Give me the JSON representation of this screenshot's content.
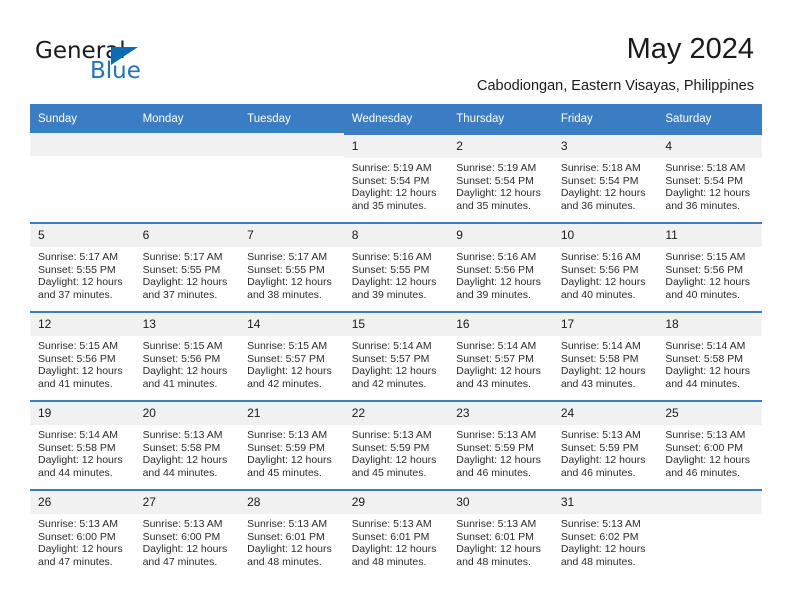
{
  "brand": {
    "name_part1": "General",
    "name_part2": "Blue",
    "accent_color": "#0b6cb6"
  },
  "header": {
    "title": "May 2024",
    "subtitle": "Cabodiongan, Eastern Visayas, Philippines",
    "header_bg_color": "#3b7dc4",
    "daynum_bg_color": "#f1f1f1"
  },
  "weekday_headers": [
    "Sunday",
    "Monday",
    "Tuesday",
    "Wednesday",
    "Thursday",
    "Friday",
    "Saturday"
  ],
  "weeks": [
    [
      {
        "day": "",
        "blank": true
      },
      {
        "day": "",
        "blank": true
      },
      {
        "day": "",
        "blank": true
      },
      {
        "day": "1",
        "sunrise": "Sunrise: 5:19 AM",
        "sunset": "Sunset: 5:54 PM",
        "daylight_line1": "Daylight: 12 hours",
        "daylight_line2": "and 35 minutes."
      },
      {
        "day": "2",
        "sunrise": "Sunrise: 5:19 AM",
        "sunset": "Sunset: 5:54 PM",
        "daylight_line1": "Daylight: 12 hours",
        "daylight_line2": "and 35 minutes."
      },
      {
        "day": "3",
        "sunrise": "Sunrise: 5:18 AM",
        "sunset": "Sunset: 5:54 PM",
        "daylight_line1": "Daylight: 12 hours",
        "daylight_line2": "and 36 minutes."
      },
      {
        "day": "4",
        "sunrise": "Sunrise: 5:18 AM",
        "sunset": "Sunset: 5:54 PM",
        "daylight_line1": "Daylight: 12 hours",
        "daylight_line2": "and 36 minutes."
      }
    ],
    [
      {
        "day": "5",
        "sunrise": "Sunrise: 5:17 AM",
        "sunset": "Sunset: 5:55 PM",
        "daylight_line1": "Daylight: 12 hours",
        "daylight_line2": "and 37 minutes."
      },
      {
        "day": "6",
        "sunrise": "Sunrise: 5:17 AM",
        "sunset": "Sunset: 5:55 PM",
        "daylight_line1": "Daylight: 12 hours",
        "daylight_line2": "and 37 minutes."
      },
      {
        "day": "7",
        "sunrise": "Sunrise: 5:17 AM",
        "sunset": "Sunset: 5:55 PM",
        "daylight_line1": "Daylight: 12 hours",
        "daylight_line2": "and 38 minutes."
      },
      {
        "day": "8",
        "sunrise": "Sunrise: 5:16 AM",
        "sunset": "Sunset: 5:55 PM",
        "daylight_line1": "Daylight: 12 hours",
        "daylight_line2": "and 39 minutes."
      },
      {
        "day": "9",
        "sunrise": "Sunrise: 5:16 AM",
        "sunset": "Sunset: 5:56 PM",
        "daylight_line1": "Daylight: 12 hours",
        "daylight_line2": "and 39 minutes."
      },
      {
        "day": "10",
        "sunrise": "Sunrise: 5:16 AM",
        "sunset": "Sunset: 5:56 PM",
        "daylight_line1": "Daylight: 12 hours",
        "daylight_line2": "and 40 minutes."
      },
      {
        "day": "11",
        "sunrise": "Sunrise: 5:15 AM",
        "sunset": "Sunset: 5:56 PM",
        "daylight_line1": "Daylight: 12 hours",
        "daylight_line2": "and 40 minutes."
      }
    ],
    [
      {
        "day": "12",
        "sunrise": "Sunrise: 5:15 AM",
        "sunset": "Sunset: 5:56 PM",
        "daylight_line1": "Daylight: 12 hours",
        "daylight_line2": "and 41 minutes."
      },
      {
        "day": "13",
        "sunrise": "Sunrise: 5:15 AM",
        "sunset": "Sunset: 5:56 PM",
        "daylight_line1": "Daylight: 12 hours",
        "daylight_line2": "and 41 minutes."
      },
      {
        "day": "14",
        "sunrise": "Sunrise: 5:15 AM",
        "sunset": "Sunset: 5:57 PM",
        "daylight_line1": "Daylight: 12 hours",
        "daylight_line2": "and 42 minutes."
      },
      {
        "day": "15",
        "sunrise": "Sunrise: 5:14 AM",
        "sunset": "Sunset: 5:57 PM",
        "daylight_line1": "Daylight: 12 hours",
        "daylight_line2": "and 42 minutes."
      },
      {
        "day": "16",
        "sunrise": "Sunrise: 5:14 AM",
        "sunset": "Sunset: 5:57 PM",
        "daylight_line1": "Daylight: 12 hours",
        "daylight_line2": "and 43 minutes."
      },
      {
        "day": "17",
        "sunrise": "Sunrise: 5:14 AM",
        "sunset": "Sunset: 5:58 PM",
        "daylight_line1": "Daylight: 12 hours",
        "daylight_line2": "and 43 minutes."
      },
      {
        "day": "18",
        "sunrise": "Sunrise: 5:14 AM",
        "sunset": "Sunset: 5:58 PM",
        "daylight_line1": "Daylight: 12 hours",
        "daylight_line2": "and 44 minutes."
      }
    ],
    [
      {
        "day": "19",
        "sunrise": "Sunrise: 5:14 AM",
        "sunset": "Sunset: 5:58 PM",
        "daylight_line1": "Daylight: 12 hours",
        "daylight_line2": "and 44 minutes."
      },
      {
        "day": "20",
        "sunrise": "Sunrise: 5:13 AM",
        "sunset": "Sunset: 5:58 PM",
        "daylight_line1": "Daylight: 12 hours",
        "daylight_line2": "and 44 minutes."
      },
      {
        "day": "21",
        "sunrise": "Sunrise: 5:13 AM",
        "sunset": "Sunset: 5:59 PM",
        "daylight_line1": "Daylight: 12 hours",
        "daylight_line2": "and 45 minutes."
      },
      {
        "day": "22",
        "sunrise": "Sunrise: 5:13 AM",
        "sunset": "Sunset: 5:59 PM",
        "daylight_line1": "Daylight: 12 hours",
        "daylight_line2": "and 45 minutes."
      },
      {
        "day": "23",
        "sunrise": "Sunrise: 5:13 AM",
        "sunset": "Sunset: 5:59 PM",
        "daylight_line1": "Daylight: 12 hours",
        "daylight_line2": "and 46 minutes."
      },
      {
        "day": "24",
        "sunrise": "Sunrise: 5:13 AM",
        "sunset": "Sunset: 5:59 PM",
        "daylight_line1": "Daylight: 12 hours",
        "daylight_line2": "and 46 minutes."
      },
      {
        "day": "25",
        "sunrise": "Sunrise: 5:13 AM",
        "sunset": "Sunset: 6:00 PM",
        "daylight_line1": "Daylight: 12 hours",
        "daylight_line2": "and 46 minutes."
      }
    ],
    [
      {
        "day": "26",
        "sunrise": "Sunrise: 5:13 AM",
        "sunset": "Sunset: 6:00 PM",
        "daylight_line1": "Daylight: 12 hours",
        "daylight_line2": "and 47 minutes."
      },
      {
        "day": "27",
        "sunrise": "Sunrise: 5:13 AM",
        "sunset": "Sunset: 6:00 PM",
        "daylight_line1": "Daylight: 12 hours",
        "daylight_line2": "and 47 minutes."
      },
      {
        "day": "28",
        "sunrise": "Sunrise: 5:13 AM",
        "sunset": "Sunset: 6:01 PM",
        "daylight_line1": "Daylight: 12 hours",
        "daylight_line2": "and 48 minutes."
      },
      {
        "day": "29",
        "sunrise": "Sunrise: 5:13 AM",
        "sunset": "Sunset: 6:01 PM",
        "daylight_line1": "Daylight: 12 hours",
        "daylight_line2": "and 48 minutes."
      },
      {
        "day": "30",
        "sunrise": "Sunrise: 5:13 AM",
        "sunset": "Sunset: 6:01 PM",
        "daylight_line1": "Daylight: 12 hours",
        "daylight_line2": "and 48 minutes."
      },
      {
        "day": "31",
        "sunrise": "Sunrise: 5:13 AM",
        "sunset": "Sunset: 6:02 PM",
        "daylight_line1": "Daylight: 12 hours",
        "daylight_line2": "and 48 minutes."
      },
      {
        "day": "",
        "blank": true
      }
    ]
  ]
}
